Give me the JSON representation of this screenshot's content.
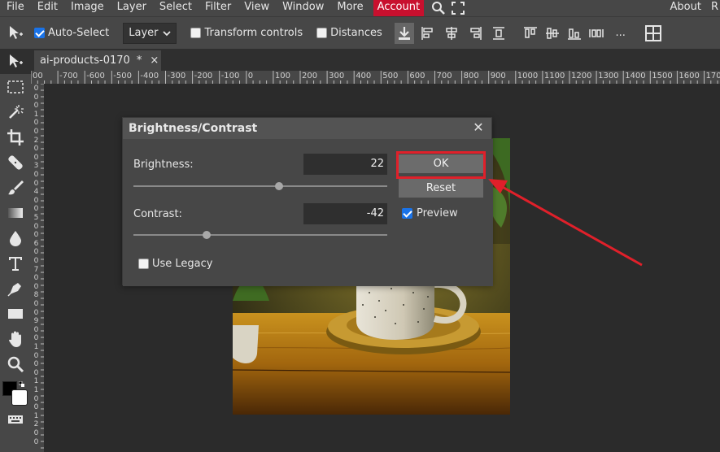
{
  "menubar": {
    "items": [
      "File",
      "Edit",
      "Image",
      "Layer",
      "Select",
      "Filter",
      "View",
      "Window",
      "More"
    ],
    "account_label": "Account",
    "about_label": "About",
    "right_cut_label": "R",
    "accent_color": "#c8102e"
  },
  "optionsbar": {
    "auto_select_label": "Auto-Select",
    "auto_select_checked": true,
    "layer_select_value": "Layer",
    "transform_controls_label": "Transform controls",
    "distances_label": "Distances",
    "more_label": "..."
  },
  "tab": {
    "filename": "ai-products-0170",
    "modified_marker": "*",
    "close_label": "×"
  },
  "ruler": {
    "top_labels": [
      "00",
      "-700",
      "-600",
      "-500",
      "-400",
      "-300",
      "-200",
      "-100",
      "0",
      "100",
      "200",
      "300",
      "400",
      "500",
      "600",
      "700",
      "800",
      "900",
      "1000",
      "1100",
      "1200",
      "1300",
      "1400",
      "1500",
      "1600",
      "170"
    ],
    "left_labels": [
      "0",
      "0",
      "0",
      "1",
      "0",
      "0",
      "2",
      "0",
      "0",
      "3",
      "0",
      "0",
      "4",
      "0",
      "0",
      "5",
      "0",
      "0",
      "6",
      "0",
      "0",
      "7",
      "0",
      "0",
      "8",
      "0",
      "0",
      "9",
      "0",
      "0",
      "1",
      "0",
      "0",
      "0",
      "1",
      "1",
      "0",
      "0",
      "1",
      "2",
      "0",
      "0"
    ]
  },
  "dialog": {
    "title": "Brightness/Contrast",
    "close_label": "✕",
    "brightness_label": "Brightness:",
    "brightness_value": "22",
    "brightness_slider_fraction": 0.575,
    "contrast_label": "Contrast:",
    "contrast_value": "-42",
    "contrast_slider_fraction": 0.29,
    "ok_label": "OK",
    "reset_label": "Reset",
    "preview_label": "Preview",
    "preview_checked": true,
    "legacy_label": "Use Legacy",
    "legacy_checked": false,
    "highlight_color": "#e0202a"
  }
}
